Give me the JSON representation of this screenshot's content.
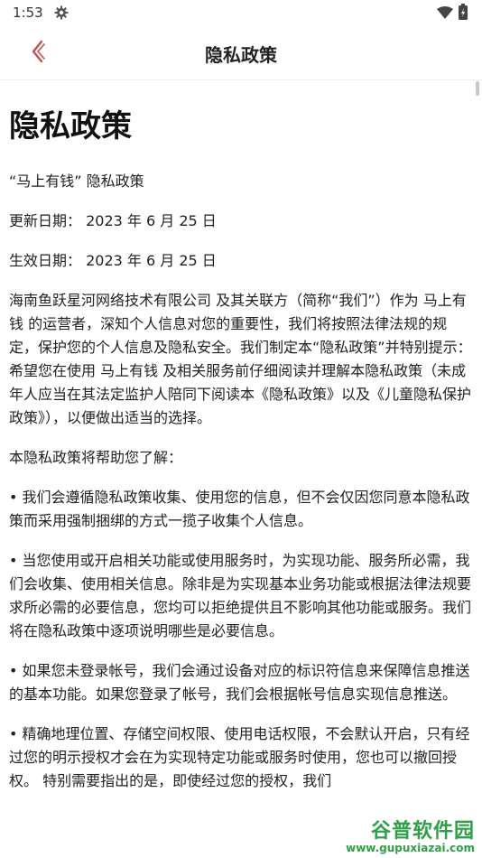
{
  "status_bar": {
    "time": "1:53",
    "icons": [
      "gear-icon",
      "wifi-icon",
      "battery-icon"
    ]
  },
  "app_bar": {
    "back_icon": "chevron-left-icon",
    "title": "隐私政策",
    "accent_color": "#c0504d"
  },
  "document": {
    "heading": "隐私政策",
    "paragraphs": [
      "“马上有钱” 隐私政策",
      "更新日期： 2023 年 6 月 25 日",
      "生效日期： 2023 年 6 月 25 日",
      "海南鱼跃星河网络技术有限公司 及其关联方（简称“我们”）作为 马上有钱 的运营者，深知个人信息对您的重要性，我们将按照法律法规的规定，保护您的个人信息及隐私安全。我们制定本“隐私政策”并特别提示：希望您在使用 马上有钱 及相关服务前仔细阅读并理解本隐私政策（未成年人应当在其法定监护人陪同下阅读本《隐私政策》以及《儿童隐私保护政策》），以便做出适当的选择。",
      "本隐私政策将帮助您了解：",
      "• 我们会遵循隐私政策收集、使用您的信息，但不会仅因您同意本隐私政策而采用强制捆绑的方式一揽子收集个人信息。",
      "• 当您使用或开启相关功能或使用服务时，为实现功能、服务所必需，我们会收集、使用相关信息。除非是为实现基本业务功能或根据法律法规要求所必需的必要信息，您均可以拒绝提供且不影响其他功能或服务。我们将在隐私政策中逐项说明哪些是必要信息。",
      "• 如果您未登录帐号，我们会通过设备对应的标识符信息来保障信息推送的基本功能。如果您登录了帐号，我们会根据帐号信息实现信息推送。",
      "• 精确地理位置、存储空间权限、使用电话权限，不会默认开启，只有经过您的明示授权才会在为实现特定功能或服务时使用，您也可以撤回授权。 特别需要指出的是，即使经过您的授权，我们"
    ]
  },
  "watermark": {
    "text": "谷普软件园",
    "url": "www.gupuxiazai.com",
    "color": "#2ea048"
  }
}
